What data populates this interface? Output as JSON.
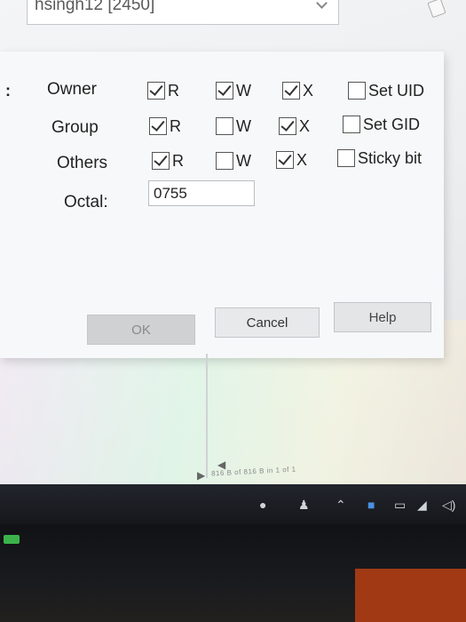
{
  "top_combo": {
    "value": "hsingh12 [2450]"
  },
  "dialog": {
    "rows": [
      {
        "label": "Owner",
        "r": "R",
        "w": "W",
        "x": "X",
        "special": "Set UID",
        "r_checked": true,
        "w_checked": true,
        "x_checked": true,
        "special_checked": false
      },
      {
        "label": "Group",
        "r": "R",
        "w": "W",
        "x": "X",
        "special": "Set GID",
        "r_checked": true,
        "w_checked": false,
        "x_checked": true,
        "special_checked": false
      },
      {
        "label": "Others",
        "r": "R",
        "w": "W",
        "x": "X",
        "special": "Sticky bit",
        "r_checked": true,
        "w_checked": false,
        "x_checked": true,
        "special_checked": false
      }
    ],
    "octal_label": "Octal:",
    "octal_value": "0755",
    "buttons": {
      "ok": "OK",
      "cancel": "Cancel",
      "help": "Help"
    }
  },
  "status_bar": {
    "text": "816 B of 816 B in 1 of 1"
  },
  "colors": {
    "dialog_bg": "#f7f8f9",
    "ok_disabled": "#cfd1d3"
  }
}
